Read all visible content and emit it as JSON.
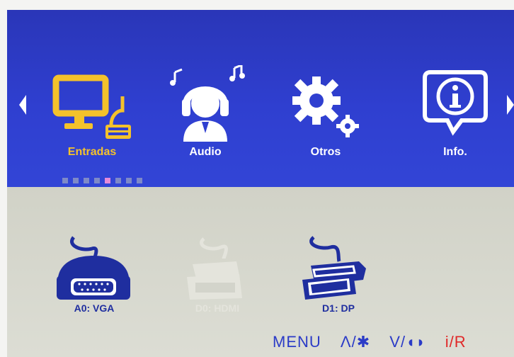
{
  "colors": {
    "header_blue": "#2f3fd0",
    "body_gray": "#d7d8cf",
    "active_yellow": "#f4c22b",
    "text_white": "#ffffff",
    "input_blue": "#1f2e9f",
    "dot_inactive": "#7e89c8",
    "dot_active": "#e58ad9",
    "hint_red": "#e02828"
  },
  "menu": {
    "left_arrow_icon": "triangle-left-icon",
    "right_arrow_icon": "triangle-right-icon",
    "tabs": [
      {
        "label": "Entradas",
        "icon": "monitor-keyboard-icon",
        "active": true
      },
      {
        "label": "Audio",
        "icon": "headphones-person-icon",
        "active": false
      },
      {
        "label": "Otros",
        "icon": "gears-icon",
        "active": false
      },
      {
        "label": "Info.",
        "icon": "info-bubble-icon",
        "active": false
      }
    ],
    "page_indicator": {
      "total": 8,
      "current": 5
    }
  },
  "inputs": [
    {
      "label": "A0: VGA",
      "icon": "vga-cable-icon",
      "enabled": true
    },
    {
      "label": "D0: HDMI",
      "icon": "hdmi-cable-icon",
      "enabled": false
    },
    {
      "label": "D1: DP",
      "icon": "displayport-cable-icon",
      "enabled": true
    }
  ],
  "hints": {
    "menu": "MENU",
    "up": "Λ/✱",
    "down": "V/◖◗",
    "input": "i/R"
  }
}
